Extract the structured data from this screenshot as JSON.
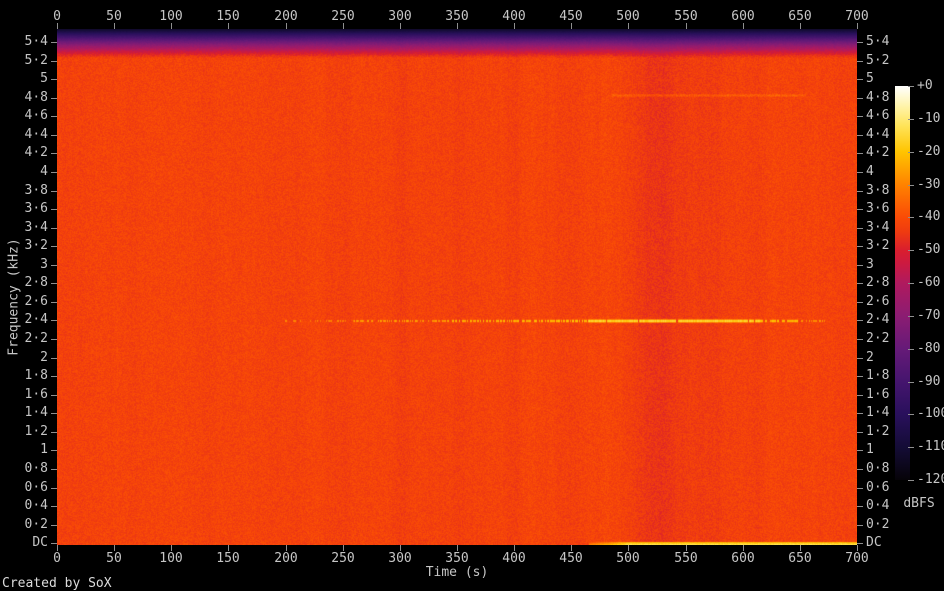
{
  "footer": {
    "credit": "Created by SoX"
  },
  "axes": {
    "x": {
      "title": "Time (s)",
      "tick_labels": [
        "0",
        "50",
        "100",
        "150",
        "200",
        "250",
        "300",
        "350",
        "400",
        "450",
        "500",
        "550",
        "600",
        "650",
        "700"
      ]
    },
    "y": {
      "title": "Frequency (kHz)",
      "tick_labels": [
        "5·4",
        "5·2",
        "5",
        "4·8",
        "4·6",
        "4·4",
        "4·2",
        "4",
        "3·8",
        "3·6",
        "3·4",
        "3·2",
        "3",
        "2·8",
        "2·6",
        "2·4",
        "2·2",
        "2",
        "1·8",
        "1·6",
        "1·4",
        "1·2",
        "1",
        "0·8",
        "0·6",
        "0·4",
        "0·2",
        "DC"
      ]
    },
    "z": {
      "title": "dBFS",
      "tick_labels": [
        "+0",
        "-10",
        "-20",
        "-30",
        "-40",
        "-50",
        "-60",
        "-70",
        "-80",
        "-90",
        "-100",
        "-110",
        "-120"
      ]
    }
  },
  "chart_data": {
    "type": "heatmap",
    "subtype": "audio-spectrogram",
    "title": "",
    "xlabel": "Time (s)",
    "ylabel": "Frequency (kHz)",
    "zlabel": "dBFS",
    "x_range_s": [
      0,
      700
    ],
    "x_tick_step_s": 50,
    "y_range_khz": [
      0,
      5.5125
    ],
    "y_tick_step_khz": 0.2,
    "z_range_db": [
      -120,
      0
    ],
    "z_tick_step_db": 10,
    "background_db": -42.2,
    "noise_amplitude_db": 6.5,
    "top_rolloff": {
      "start_khz": 5.2,
      "min_db": -112
    },
    "faint_line": {
      "freq_khz": 4.83,
      "t0_s": 485,
      "t1_s": 655,
      "boost_db": 5
    },
    "tone_line": {
      "freq_khz": 2.4,
      "segments": [
        {
          "t0": 198,
          "t1": 260,
          "db": -31,
          "duty": 0.3
        },
        {
          "t0": 260,
          "t1": 340,
          "db": -27,
          "duty": 0.5
        },
        {
          "t0": 340,
          "t1": 430,
          "db": -24,
          "duty": 0.6
        },
        {
          "t0": 430,
          "t1": 465,
          "db": -22,
          "duty": 0.72
        },
        {
          "t0": 465,
          "t1": 615,
          "db": -17,
          "duty": 0.97
        },
        {
          "t0": 615,
          "t1": 648,
          "db": -22,
          "duty": 0.7
        },
        {
          "t0": 648,
          "t1": 672,
          "db": -28,
          "duty": 0.4
        }
      ]
    },
    "dc_line": {
      "t0_s": 465,
      "t1_s": 700,
      "peak_db": -14,
      "edge_db": -32
    },
    "vertical_dark_bands": [
      {
        "time_s": 252,
        "width_s": 14,
        "ddb": -0.8
      },
      {
        "time_s": 300,
        "width_s": 14,
        "ddb": -0.9
      },
      {
        "time_s": 350,
        "width_s": 16,
        "ddb": -1.1
      },
      {
        "time_s": 402,
        "width_s": 14,
        "ddb": -0.9
      },
      {
        "time_s": 452,
        "width_s": 14,
        "ddb": -1.0
      },
      {
        "time_s": 525,
        "width_s": 38,
        "ddb": -3.2
      },
      {
        "time_s": 572,
        "width_s": 26,
        "ddb": -2.4
      }
    ],
    "palette": [
      {
        "level": 0.0,
        "color": "#060308"
      },
      {
        "level": 0.083,
        "color": "#140c36"
      },
      {
        "level": 0.167,
        "color": "#29105c"
      },
      {
        "level": 0.25,
        "color": "#45156e"
      },
      {
        "level": 0.333,
        "color": "#661a78"
      },
      {
        "level": 0.417,
        "color": "#8c1c72"
      },
      {
        "level": 0.5,
        "color": "#b01a5e"
      },
      {
        "level": 0.55,
        "color": "#cc1a40"
      },
      {
        "level": 0.583,
        "color": "#d91e2e"
      },
      {
        "level": 0.63,
        "color": "#ef3b10"
      },
      {
        "level": 0.667,
        "color": "#fa4b06"
      },
      {
        "level": 0.75,
        "color": "#ff8300"
      },
      {
        "level": 0.833,
        "color": "#ffc400"
      },
      {
        "level": 0.9,
        "color": "#ffe45a"
      },
      {
        "level": 0.95,
        "color": "#fff4ac"
      },
      {
        "level": 1.0,
        "color": "#ffffff"
      }
    ],
    "legend_position": "right-colorbar",
    "grid": false
  },
  "colors": {
    "background": "#000000",
    "tick": "#8f8f8f",
    "label": "#c6c6c6",
    "footer_text": "#dcdcdc"
  }
}
